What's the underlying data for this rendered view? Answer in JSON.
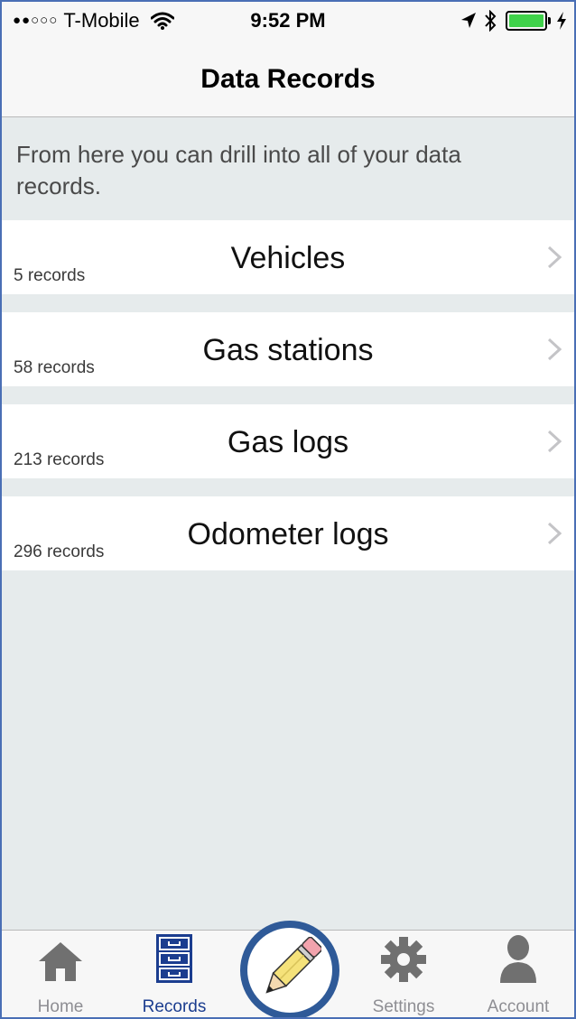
{
  "status_bar": {
    "signal": "●●○○○",
    "carrier": "T-Mobile",
    "time": "9:52 PM"
  },
  "nav": {
    "title": "Data Records"
  },
  "intro": "From here you can drill into all of your data records.",
  "rows": [
    {
      "title": "Vehicles",
      "count": "5 records"
    },
    {
      "title": "Gas stations",
      "count": "58 records"
    },
    {
      "title": "Gas logs",
      "count": "213 records"
    },
    {
      "title": "Odometer logs",
      "count": "296 records"
    }
  ],
  "tabs": [
    {
      "label": "Home",
      "icon": "home-icon"
    },
    {
      "label": "Records",
      "icon": "filing-cabinet-icon",
      "active": true
    },
    {
      "label": "",
      "icon": "pencil-icon"
    },
    {
      "label": "Settings",
      "icon": "gear-icon"
    },
    {
      "label": "Account",
      "icon": "person-icon"
    }
  ],
  "colors": {
    "accent": "#1b3d8f",
    "background": "#e6ebec",
    "battery": "#3fd24a",
    "fab_ring": "#2f5a98"
  }
}
